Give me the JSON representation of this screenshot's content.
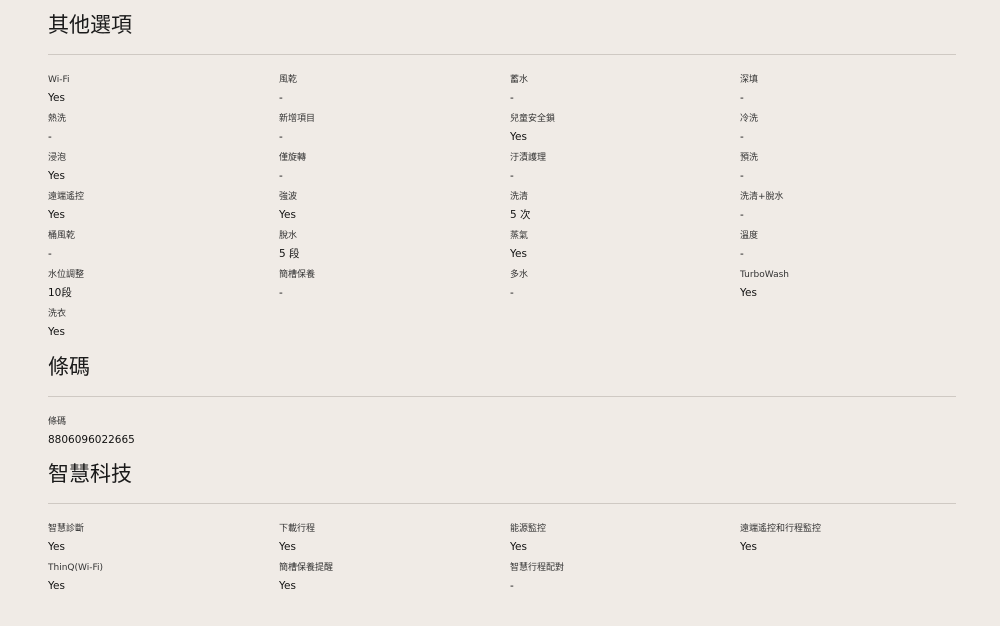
{
  "sections": [
    {
      "title": "其他選項",
      "items": [
        {
          "label": "Wi-Fi",
          "value": "Yes"
        },
        {
          "label": "風乾",
          "value": "-"
        },
        {
          "label": "蓄水",
          "value": "-"
        },
        {
          "label": "深填",
          "value": "-"
        },
        {
          "label": "熱洗",
          "value": "-"
        },
        {
          "label": "新增項目",
          "value": "-"
        },
        {
          "label": "兒童安全鎖",
          "value": "Yes"
        },
        {
          "label": "冷洗",
          "value": "-"
        },
        {
          "label": "浸泡",
          "value": "Yes"
        },
        {
          "label": "僅旋轉",
          "value": "-"
        },
        {
          "label": "汙漬護理",
          "value": "-"
        },
        {
          "label": "預洗",
          "value": "-"
        },
        {
          "label": "遠端遙控",
          "value": "Yes"
        },
        {
          "label": "強波",
          "value": "Yes"
        },
        {
          "label": "洗清",
          "value": "5 次"
        },
        {
          "label": "洗清+脫水",
          "value": "-"
        },
        {
          "label": "桶風乾",
          "value": "-"
        },
        {
          "label": "脫水",
          "value": "5 段"
        },
        {
          "label": "蒸氣",
          "value": "Yes"
        },
        {
          "label": "溫度",
          "value": "-"
        },
        {
          "label": "水位調整",
          "value": "10段"
        },
        {
          "label": "簡槽保養",
          "value": "-"
        },
        {
          "label": "多水",
          "value": "-"
        },
        {
          "label": "TurboWash",
          "value": "Yes"
        },
        {
          "label": "洗衣",
          "value": "Yes"
        }
      ]
    },
    {
      "title": "條碼",
      "items": [
        {
          "label": "條碼",
          "value": "8806096022665"
        }
      ]
    },
    {
      "title": "智慧科技",
      "items": [
        {
          "label": "智慧診斷",
          "value": "Yes"
        },
        {
          "label": "下載行程",
          "value": "Yes"
        },
        {
          "label": "能源監控",
          "value": "Yes"
        },
        {
          "label": "遠端遙控和行程監控",
          "value": "Yes"
        },
        {
          "label": "ThinQ(Wi-Fi)",
          "value": "Yes"
        },
        {
          "label": "簡槽保養提醒",
          "value": "Yes"
        },
        {
          "label": "智慧行程配對",
          "value": "-"
        }
      ]
    }
  ]
}
